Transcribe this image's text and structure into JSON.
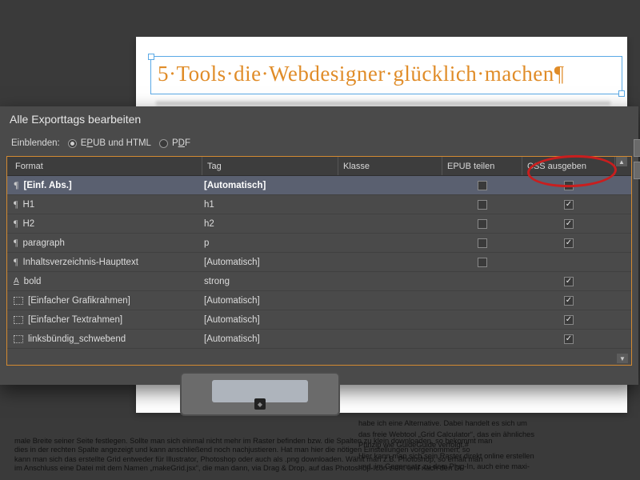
{
  "document": {
    "headline": "5·Tools·die·Webdesigner·glücklich·machen¶",
    "article_snippet_1": "habe ich eine Alternative. Dabei handelt es sich um",
    "article_snippet_2": "das freie Webtool „Grid Calculator“, das ein ähnliches",
    "article_snippet_3": "Prinzip wie GuideGuide verfolgt.#",
    "article_snippet_4": "Hier kann man sich sein Raster direkt online erstellen",
    "article_snippet_5": "und, im Gegensatz zu dem Plug-In, auch eine maxi-",
    "article_wide_1": "male Breite seiner Seite festlegen. Sollte man sich einmal nicht mehr im Raster befinden bzw. die Spalten zu klein downloaden, so bekommt man",
    "article_wide_2": "dies in der rechten Spalte angezeigt und kann anschließend noch nachjustieren. Hat man hier die nötigen Einstellungen vorgenommen, so",
    "article_wide_3": "kann man sich das erstellte Grid entweder für Illustrator, Photoshop oder auch als .png downloaden. Wählt man z.B. Photoshop, so erhält man",
    "article_wide_4": "im Anschluss eine Datei mit dem Namen „makeGrid.jsx“, die man dann, via Drag & Drop, auf das Photoshop-Icon zieht und nach den Di-"
  },
  "dialog": {
    "title": "Alle Exporttags bearbeiten",
    "show_label": "Einblenden:",
    "radio_epub_pre": "E",
    "radio_epub_ul": "P",
    "radio_epub_post": "UB und HTML",
    "radio_pdf_pre": "P",
    "radio_pdf_ul": "D",
    "radio_pdf_post": "F",
    "columns": {
      "format": "Format",
      "tag": "Tag",
      "klasse": "Klasse",
      "epub_teilen": "EPUB teilen",
      "css_ausgeben": "CSS ausgeben"
    },
    "rows": [
      {
        "icon": "para",
        "format": "[Einf. Abs.]",
        "tag": "[Automatisch]",
        "epub": false,
        "css": false,
        "selected": true
      },
      {
        "icon": "para",
        "format": "H1",
        "tag": "h1",
        "epub": false,
        "css": true
      },
      {
        "icon": "para",
        "format": "H2",
        "tag": "h2",
        "epub": false,
        "css": true
      },
      {
        "icon": "para",
        "format": "paragraph",
        "tag": "p",
        "epub": false,
        "css": true
      },
      {
        "icon": "para",
        "format": "Inhaltsverzeichnis-Haupttext",
        "tag": "[Automatisch]",
        "epub": false,
        "css": null
      },
      {
        "icon": "char",
        "format": "bold",
        "tag": "strong",
        "epub": null,
        "css": true
      },
      {
        "icon": "frame",
        "format": "[Einfacher Grafikrahmen]",
        "tag": "[Automatisch]",
        "epub": null,
        "css": true
      },
      {
        "icon": "frame",
        "format": "[Einfacher Textrahmen]",
        "tag": "[Automatisch]",
        "epub": null,
        "css": true
      },
      {
        "icon": "frame",
        "format": "linksbündig_schwebend",
        "tag": "[Automatisch]",
        "epub": null,
        "css": true
      }
    ]
  }
}
